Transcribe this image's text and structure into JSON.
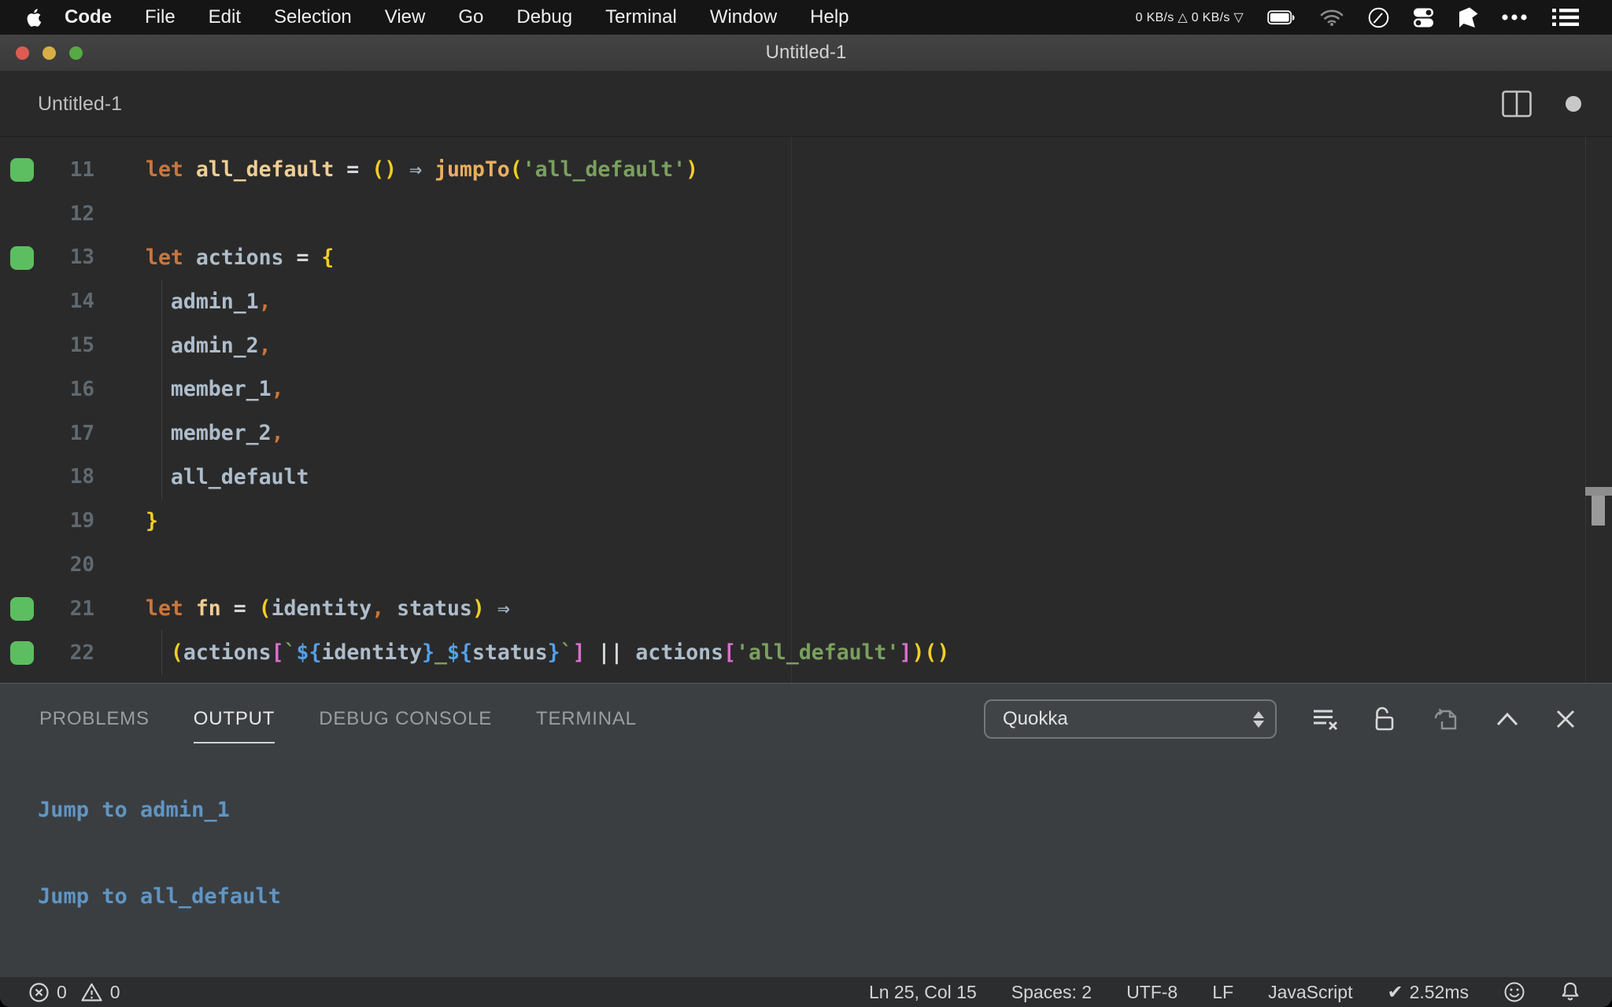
{
  "menubar": {
    "items": [
      "Code",
      "File",
      "Edit",
      "Selection",
      "View",
      "Go",
      "Debug",
      "Terminal",
      "Window",
      "Help"
    ],
    "net_up": "0 KB/s △",
    "net_down": "0 KB/s ▽"
  },
  "titlebar": {
    "title": "Untitled-1"
  },
  "tabbar": {
    "title": "Untitled-1"
  },
  "editor": {
    "lines": [
      {
        "num": "11",
        "mark": true,
        "guide": false,
        "tokens": [
          {
            "c": "kw",
            "t": "let "
          },
          {
            "c": "decl",
            "t": "all_default"
          },
          {
            "c": "op",
            "t": " = "
          },
          {
            "c": "par",
            "t": "()"
          },
          {
            "c": "arr",
            "t": " ⇒ "
          },
          {
            "c": "fn",
            "t": "jumpTo"
          },
          {
            "c": "par",
            "t": "("
          },
          {
            "c": "str",
            "t": "'all_default'"
          },
          {
            "c": "par",
            "t": ")"
          }
        ]
      },
      {
        "num": "12",
        "mark": false,
        "guide": false,
        "tokens": []
      },
      {
        "num": "13",
        "mark": true,
        "guide": false,
        "tokens": [
          {
            "c": "kw",
            "t": "let "
          },
          {
            "c": "id",
            "t": "actions"
          },
          {
            "c": "op",
            "t": " = "
          },
          {
            "c": "brace",
            "t": "{"
          }
        ]
      },
      {
        "num": "14",
        "mark": false,
        "guide": true,
        "tokens": [
          {
            "c": "sp",
            "t": "  "
          },
          {
            "c": "id",
            "t": "admin_1"
          },
          {
            "c": "pun",
            "t": ","
          }
        ]
      },
      {
        "num": "15",
        "mark": false,
        "guide": true,
        "tokens": [
          {
            "c": "sp",
            "t": "  "
          },
          {
            "c": "id",
            "t": "admin_2"
          },
          {
            "c": "pun",
            "t": ","
          }
        ]
      },
      {
        "num": "16",
        "mark": false,
        "guide": true,
        "tokens": [
          {
            "c": "sp",
            "t": "  "
          },
          {
            "c": "id",
            "t": "member_1"
          },
          {
            "c": "pun",
            "t": ","
          }
        ]
      },
      {
        "num": "17",
        "mark": false,
        "guide": true,
        "tokens": [
          {
            "c": "sp",
            "t": "  "
          },
          {
            "c": "id",
            "t": "member_2"
          },
          {
            "c": "pun",
            "t": ","
          }
        ]
      },
      {
        "num": "18",
        "mark": false,
        "guide": true,
        "tokens": [
          {
            "c": "sp",
            "t": "  "
          },
          {
            "c": "id",
            "t": "all_default"
          }
        ]
      },
      {
        "num": "19",
        "mark": false,
        "guide": false,
        "tokens": [
          {
            "c": "brace",
            "t": "}"
          }
        ]
      },
      {
        "num": "20",
        "mark": false,
        "guide": false,
        "tokens": []
      },
      {
        "num": "21",
        "mark": true,
        "guide": false,
        "tokens": [
          {
            "c": "kw",
            "t": "let "
          },
          {
            "c": "decl",
            "t": "fn"
          },
          {
            "c": "op",
            "t": " = "
          },
          {
            "c": "par",
            "t": "("
          },
          {
            "c": "id",
            "t": "identity"
          },
          {
            "c": "pun",
            "t": ", "
          },
          {
            "c": "id",
            "t": "status"
          },
          {
            "c": "par",
            "t": ")"
          },
          {
            "c": "arr",
            "t": " ⇒"
          }
        ]
      },
      {
        "num": "22",
        "mark": true,
        "guide": true,
        "tokens": [
          {
            "c": "sp",
            "t": "  "
          },
          {
            "c": "par",
            "t": "("
          },
          {
            "c": "id",
            "t": "actions"
          },
          {
            "c": "brk",
            "t": "["
          },
          {
            "c": "tstr",
            "t": "`"
          },
          {
            "c": "tpl",
            "t": "${"
          },
          {
            "c": "id",
            "t": "identity"
          },
          {
            "c": "tpl",
            "t": "}"
          },
          {
            "c": "tstr",
            "t": "_"
          },
          {
            "c": "tpl",
            "t": "${"
          },
          {
            "c": "id",
            "t": "status"
          },
          {
            "c": "tpl",
            "t": "}"
          },
          {
            "c": "tstr",
            "t": "`"
          },
          {
            "c": "brk",
            "t": "]"
          },
          {
            "c": "op",
            "t": " || "
          },
          {
            "c": "id",
            "t": "actions"
          },
          {
            "c": "brk",
            "t": "["
          },
          {
            "c": "str",
            "t": "'all_default'"
          },
          {
            "c": "brk",
            "t": "]"
          },
          {
            "c": "par",
            "t": ")"
          },
          {
            "c": "par",
            "t": "()"
          }
        ]
      }
    ]
  },
  "panel": {
    "tabs": [
      {
        "label": "PROBLEMS",
        "active": false
      },
      {
        "label": "OUTPUT",
        "active": true
      },
      {
        "label": "DEBUG CONSOLE",
        "active": false
      },
      {
        "label": "TERMINAL",
        "active": false
      }
    ],
    "picker": "Quokka"
  },
  "output": {
    "lines": [
      "Jump to admin_1",
      "",
      "Jump to all_default"
    ]
  },
  "statusbar": {
    "error_count": "0",
    "warning_count": "0",
    "items": [
      "Ln 25, Col 15",
      "Spaces: 2",
      "UTF-8",
      "LF",
      "JavaScript"
    ],
    "check_glyph": "✔",
    "quokka_time": "2.52ms"
  },
  "colors": {
    "keyword": "#C9763D",
    "declaration": "#EFCE93",
    "function": "#EBAE5E",
    "identifier": "#AEBDCB",
    "string": "#7AA05F",
    "paren": "#F2CE24",
    "bracket": "#D96FCB",
    "template_expr": "#55A0E8",
    "arrow": "#9FB0C0",
    "coverage_green": "#5CBE60",
    "output_text": "#6095C4",
    "editor_bg": "#2A2A2A",
    "panel_bg": "#3A3E41"
  }
}
